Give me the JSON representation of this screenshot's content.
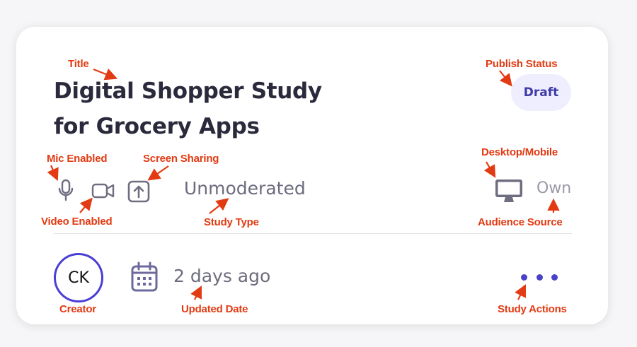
{
  "card": {
    "title": "Digital Shopper Study for Grocery Apps",
    "publish_status": "Draft",
    "study_type": "Unmoderated",
    "audience_source": "Own",
    "creator_initials": "CK",
    "updated": "2 days ago"
  },
  "icons": {
    "mic": "microphone-icon",
    "video": "video-camera-icon",
    "screen_share": "screen-share-icon",
    "device": "desktop-monitor-icon",
    "calendar": "calendar-icon",
    "actions": "more-horizontal-icon"
  },
  "annotations": {
    "title": "Title",
    "publish_status": "Publish Status",
    "mic_enabled": "Mic Enabled",
    "screen_sharing": "Screen Sharing",
    "desktop_mobile": "Desktop/Mobile",
    "video_enabled": "Video Enabled",
    "study_type": "Study Type",
    "audience_source": "Audience Source",
    "creator": "Creator",
    "updated_date": "Updated Date",
    "study_actions": "Study Actions"
  },
  "colors": {
    "accent": "#4a3fd4",
    "annotation": "#e23a12",
    "badge_bg": "#eeeefe",
    "badge_text": "#3d3aa6"
  }
}
